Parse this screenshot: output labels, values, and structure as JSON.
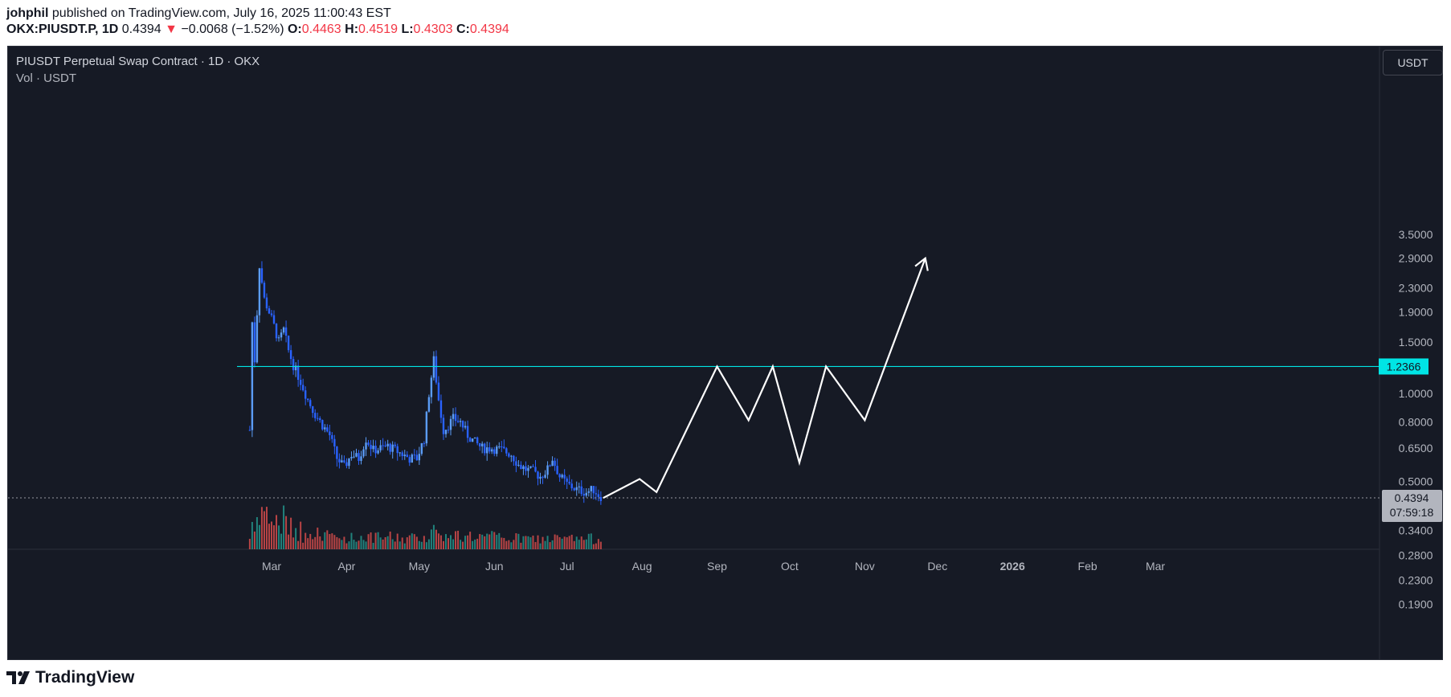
{
  "header": {
    "user": "johphil",
    "published": "published on TradingView.com, July 16, 2025 11:00:43 EST"
  },
  "ohlc": {
    "symbol": "OKX:PIUSDT.P, 1D",
    "last": "0.4394",
    "arrow": "▼",
    "change": "−0.0068 (−1.52%)",
    "o_label": "O:",
    "o": "0.4463",
    "h_label": "H:",
    "h": "0.4519",
    "l_label": "L:",
    "l": "0.4303",
    "c_label": "C:",
    "c": "0.4394"
  },
  "chart_title": "PIUSDT Perpetual Swap Contract · 1D · OKX",
  "vol_label": "Vol · USDT",
  "currency_button": "USDT",
  "footer": {
    "brand": "TradingView"
  },
  "colors": {
    "background": "#161a25",
    "up": "#5b9cf6",
    "down": "#2962ff",
    "vol_up": "#26a69a",
    "vol_down": "#ef5350",
    "level_line": "#00e5e5",
    "drawing": "#ffffff"
  },
  "chart_data": {
    "type": "candlestick",
    "y_scale": "log",
    "y_ticks": [
      "3.5000",
      "2.9000",
      "2.3000",
      "1.9000",
      "1.5000",
      "1.0000",
      "0.8000",
      "0.6500",
      "0.5000",
      "0.3400",
      "0.2800",
      "0.2300",
      "0.1900"
    ],
    "y_tick_values": [
      3.5,
      2.9,
      2.3,
      1.9,
      1.5,
      1.0,
      0.8,
      0.65,
      0.5,
      0.34,
      0.28,
      0.23,
      0.19
    ],
    "x_ticks": [
      "Mar",
      "Apr",
      "May",
      "Jun",
      "Jul",
      "Aug",
      "Sep",
      "Oct",
      "Nov",
      "Dec",
      "2026",
      "Feb",
      "Mar"
    ],
    "x_tick_dates": [
      "2025-03-01",
      "2025-04-01",
      "2025-05-01",
      "2025-06-01",
      "2025-07-01",
      "2025-08-01",
      "2025-09-01",
      "2025-10-01",
      "2025-11-01",
      "2025-12-01",
      "2026-01-01",
      "2026-02-01",
      "2026-03-01"
    ],
    "level_label": "1.2366",
    "level_value": 1.2366,
    "last_price_label": "0.4394",
    "last_price_value": 0.4394,
    "countdown": "07:59:18",
    "price_path": [
      [
        "2025-02-20",
        0.75
      ],
      [
        "2025-02-21",
        1.75
      ],
      [
        "2025-02-22",
        1.3
      ],
      [
        "2025-02-24",
        2.75
      ],
      [
        "2025-02-26",
        2.1
      ],
      [
        "2025-02-28",
        1.9
      ],
      [
        "2025-03-02",
        1.7
      ],
      [
        "2025-03-04",
        1.5
      ],
      [
        "2025-03-06",
        1.65
      ],
      [
        "2025-03-08",
        1.4
      ],
      [
        "2025-03-10",
        1.25
      ],
      [
        "2025-03-13",
        1.1
      ],
      [
        "2025-03-16",
        0.95
      ],
      [
        "2025-03-19",
        0.85
      ],
      [
        "2025-03-22",
        0.78
      ],
      [
        "2025-03-25",
        0.72
      ],
      [
        "2025-03-28",
        0.6
      ],
      [
        "2025-03-31",
        0.56
      ],
      [
        "2025-04-03",
        0.62
      ],
      [
        "2025-04-06",
        0.6
      ],
      [
        "2025-04-09",
        0.7
      ],
      [
        "2025-04-12",
        0.64
      ],
      [
        "2025-04-15",
        0.65
      ],
      [
        "2025-04-18",
        0.66
      ],
      [
        "2025-04-21",
        0.64
      ],
      [
        "2025-04-24",
        0.62
      ],
      [
        "2025-04-27",
        0.6
      ],
      [
        "2025-04-30",
        0.6
      ],
      [
        "2025-05-03",
        0.7
      ],
      [
        "2025-05-05",
        1.0
      ],
      [
        "2025-05-07",
        1.3
      ],
      [
        "2025-05-09",
        0.95
      ],
      [
        "2025-05-11",
        0.75
      ],
      [
        "2025-05-13",
        0.78
      ],
      [
        "2025-05-15",
        0.82
      ],
      [
        "2025-05-18",
        0.8
      ],
      [
        "2025-05-21",
        0.72
      ],
      [
        "2025-05-24",
        0.68
      ],
      [
        "2025-05-27",
        0.65
      ],
      [
        "2025-05-31",
        0.65
      ],
      [
        "2025-06-04",
        0.64
      ],
      [
        "2025-06-08",
        0.62
      ],
      [
        "2025-06-11",
        0.57
      ],
      [
        "2025-06-14",
        0.55
      ],
      [
        "2025-06-17",
        0.54
      ],
      [
        "2025-06-20",
        0.52
      ],
      [
        "2025-06-23",
        0.55
      ],
      [
        "2025-06-25",
        0.6
      ],
      [
        "2025-06-28",
        0.52
      ],
      [
        "2025-07-01",
        0.49
      ],
      [
        "2025-07-05",
        0.47
      ],
      [
        "2025-07-09",
        0.46
      ],
      [
        "2025-07-12",
        0.47
      ],
      [
        "2025-07-14",
        0.45
      ],
      [
        "2025-07-16",
        0.4394
      ]
    ],
    "projection_path": [
      [
        "2025-07-16",
        0.4394
      ],
      [
        "2025-07-31",
        0.51
      ],
      [
        "2025-08-07",
        0.46
      ],
      [
        "2025-09-01",
        1.2366
      ],
      [
        "2025-09-14",
        0.81
      ],
      [
        "2025-09-24",
        1.2366
      ],
      [
        "2025-10-05",
        0.58
      ],
      [
        "2025-10-16",
        1.2366
      ],
      [
        "2025-11-01",
        0.81
      ],
      [
        "2025-11-26",
        2.9
      ]
    ]
  }
}
